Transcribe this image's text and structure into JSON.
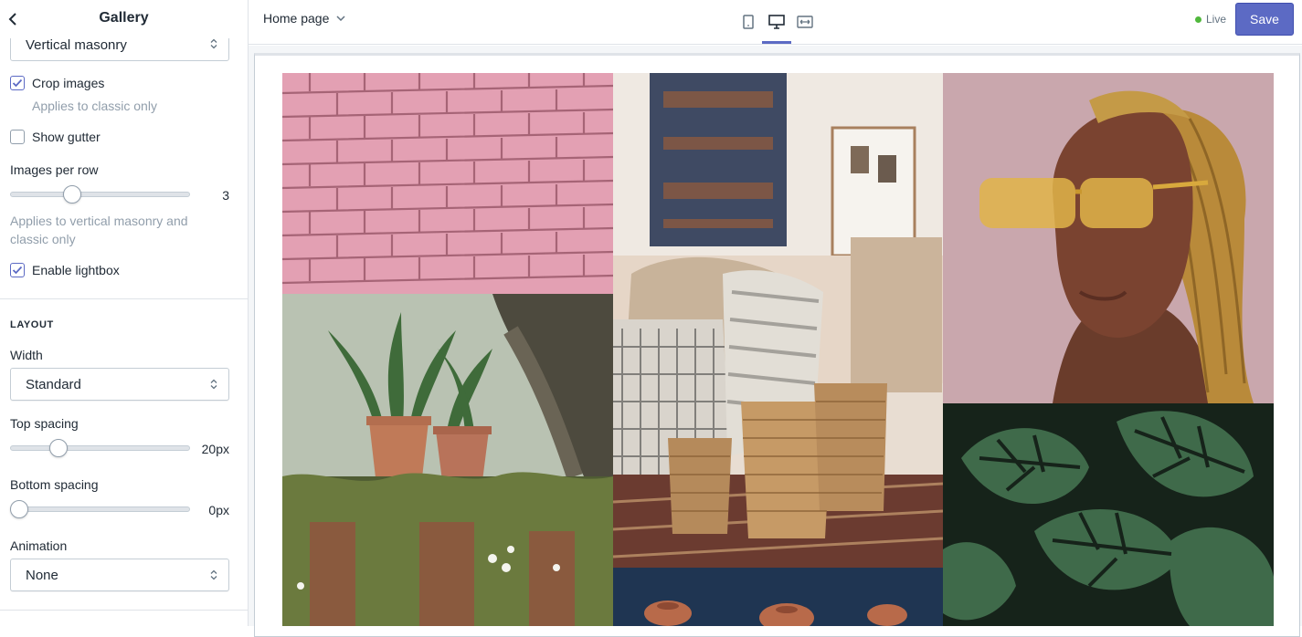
{
  "sidebar": {
    "title": "Gallery",
    "layout_style_select": "Vertical masonry",
    "crop_images": {
      "label": "Crop images",
      "help": "Applies to classic only",
      "checked": true
    },
    "show_gutter": {
      "label": "Show gutter",
      "checked": false
    },
    "images_per_row": {
      "label": "Images per row",
      "value": "3",
      "help": "Applies to vertical masonry and classic only"
    },
    "enable_lightbox": {
      "label": "Enable lightbox",
      "checked": true
    },
    "layout": {
      "heading": "LAYOUT",
      "width": {
        "label": "Width",
        "value": "Standard"
      },
      "top_spacing": {
        "label": "Top spacing",
        "value": "20px"
      },
      "bottom_spacing": {
        "label": "Bottom spacing",
        "value": "0px"
      },
      "animation": {
        "label": "Animation",
        "value": "None"
      }
    }
  },
  "topbar": {
    "page_select": "Home page",
    "devices": [
      "mobile-icon",
      "desktop-icon",
      "fullscreen-icon"
    ],
    "active_device": "desktop",
    "live_label": "Live",
    "save_label": "Save"
  },
  "gallery": {
    "images": [
      "pink brick wall",
      "boho interior with woven baskets",
      "woman with yellow sunglasses and braids",
      "snowdrops in terracotta pots",
      "monstera leaves",
      "clay pots on blue"
    ]
  },
  "colors": {
    "accent": "#5c6ac4",
    "live": "#50b83c",
    "border": "#dfe3e8",
    "muted": "#919eab"
  }
}
